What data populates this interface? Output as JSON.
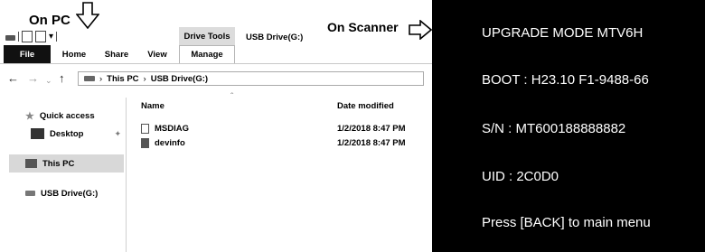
{
  "captions": {
    "pc": "On PC",
    "scanner": "On Scanner"
  },
  "window": {
    "title": "USB Drive(G:)",
    "context_group": "Drive Tools"
  },
  "ribbon": {
    "tabs": [
      "File",
      "Home",
      "Share",
      "View",
      "Manage"
    ]
  },
  "address": {
    "crumbs": [
      "This PC",
      "USB Drive(G:)"
    ]
  },
  "sidebar": {
    "items": [
      {
        "label": "Quick access",
        "icon": "star-icon"
      },
      {
        "label": "Desktop",
        "icon": "desktop-icon",
        "pinned": true
      },
      {
        "label": "This PC",
        "icon": "computer-icon",
        "selected": true
      },
      {
        "label": "USB Drive(G:)",
        "icon": "usb-drive-icon"
      }
    ]
  },
  "files": {
    "columns": [
      "Name",
      "Date modified"
    ],
    "rows": [
      {
        "name": "MSDIAG",
        "date": "1/2/2018 8:47 PM",
        "icon": "file-icon"
      },
      {
        "name": "devinfo",
        "date": "1/2/2018 8:47 PM",
        "icon": "file-icon"
      }
    ]
  },
  "scanner": {
    "lines": [
      "UPGRADE MODE MTV6H",
      "BOOT : H23.10  F1-9488-66",
      "S/N : MT600188888882",
      "UID : 2C0D0",
      "Press [BACK] to main menu"
    ]
  },
  "colors": {
    "screen_bg": "#000000",
    "screen_text": "#ffffff",
    "file_tab_bg": "#111111",
    "selected_bg": "#d8d8d8"
  }
}
